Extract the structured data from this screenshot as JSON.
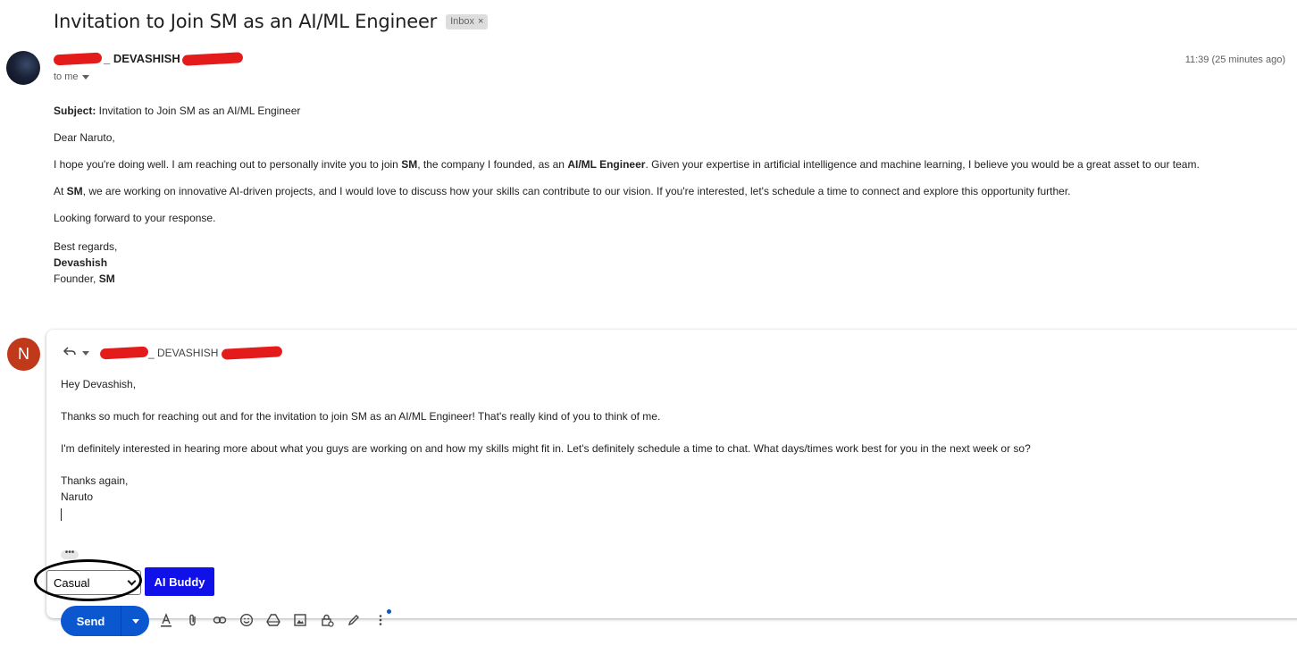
{
  "thread": {
    "subject": "Invitation to Join SM as an AI/ML Engineer",
    "label": "Inbox",
    "label_close": "×"
  },
  "message": {
    "sender_name": "_ DEVASHISH",
    "to_line": "to me",
    "timestamp": "11:39 (25 minutes ago)",
    "subject_label": "Subject:",
    "subject_text": " Invitation to Join SM as an AI/ML Engineer",
    "greeting": "Dear Naruto,",
    "p1_a": "I hope you're doing well. I am reaching out to personally invite you to join ",
    "p1_b": "SM",
    "p1_c": ", the company I founded, as an ",
    "p1_d": "AI/ML Engineer",
    "p1_e": ". Given your expertise in artificial intelligence and machine learning, I believe you would be a great asset to our team.",
    "p2_a": "At ",
    "p2_b": "SM",
    "p2_c": ", we are working on innovative AI-driven projects, and I would love to discuss how your skills can contribute to our vision. If you're interested, let's schedule a time to connect and explore this opportunity further.",
    "p3": "Looking forward to your response.",
    "closing": "Best regards,",
    "signature_name": "Devashish",
    "signature_role": "Founder, ",
    "signature_company": "SM"
  },
  "reply": {
    "avatar_initial": "N",
    "recipient_name": "_ DEVASHISH",
    "line1": "Hey Devashish,",
    "line2": "Thanks so much for reaching out and for the invitation to join SM as an AI/ML Engineer! That's really kind of you to think of me.",
    "line3": "I'm definitely interested in hearing more about what you guys are working on and how my skills might fit in. Let's definitely schedule a time to chat. What days/times work best for you in the next week or so?",
    "line4": "Thanks again,",
    "line5": "Naruto",
    "ellipsis": "•••",
    "tone_selected": "Casual",
    "ai_button": "AI Buddy",
    "send_label": "Send"
  },
  "colors": {
    "send_blue": "#0b57d0",
    "ai_buddy_blue": "#1010e8",
    "avatar_n": "#c0391b",
    "redaction": "#e31b1b"
  },
  "toolbar_icons": [
    "format-text-icon",
    "attach-icon",
    "link-icon",
    "emoji-icon",
    "drive-icon",
    "photo-icon",
    "confidential-lock-icon",
    "signature-pen-icon",
    "more-options-icon"
  ]
}
